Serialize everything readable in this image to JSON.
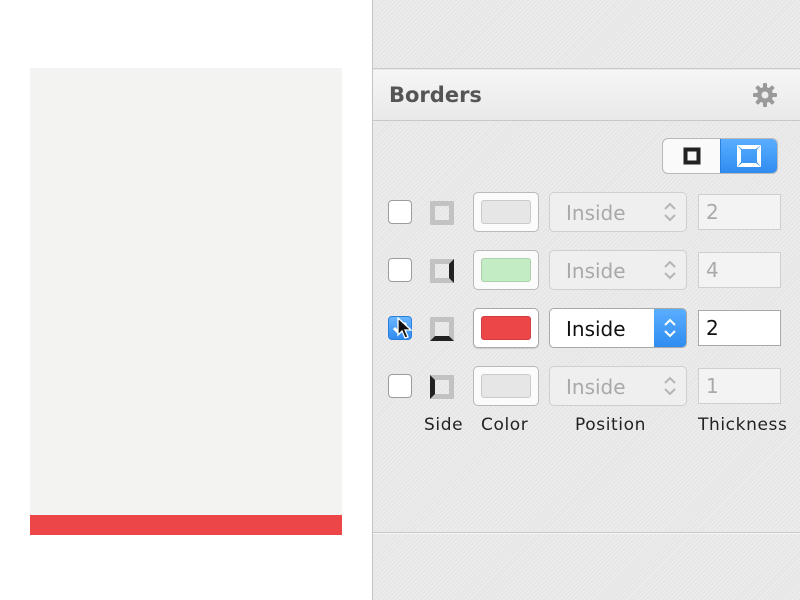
{
  "panel": {
    "title": "Borders",
    "settings_icon": "gear-icon"
  },
  "toggle": {
    "options": [
      {
        "icon": "square-border-icon",
        "active": false
      },
      {
        "icon": "side-border-icon",
        "active": true
      }
    ]
  },
  "columns": {
    "side": "Side",
    "color": "Color",
    "position": "Position",
    "thickness": "Thickness"
  },
  "borders": [
    {
      "checked": false,
      "side": "all",
      "color": "#e6e6e6",
      "position": "Inside",
      "thickness": "2"
    },
    {
      "checked": false,
      "side": "right",
      "color": "#c4ecc4",
      "position": "Inside",
      "thickness": "4"
    },
    {
      "checked": true,
      "side": "bottom",
      "color": "#ec4649",
      "position": "Inside",
      "thickness": "2"
    },
    {
      "checked": false,
      "side": "left",
      "color": "#e6e6e6",
      "position": "Inside",
      "thickness": "1"
    }
  ],
  "canvas": {
    "artboard_color": "#f3f3f2",
    "border_color": "#ec4649"
  },
  "accent_color": "#2f8cf0"
}
